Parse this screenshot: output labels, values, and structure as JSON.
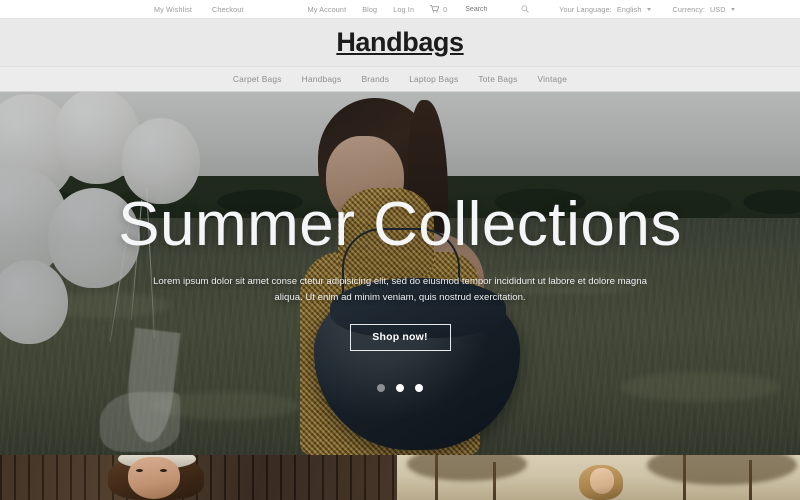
{
  "topbar": {
    "left_links": [
      {
        "label": "My Wishlist",
        "name": "my-wishlist-link"
      },
      {
        "label": "Checkout",
        "name": "checkout-link"
      }
    ],
    "mid_links": [
      {
        "label": "My Account",
        "name": "my-account-link"
      },
      {
        "label": "Blog",
        "name": "blog-link"
      },
      {
        "label": "Log In",
        "name": "log-in-link"
      }
    ],
    "cart": {
      "icon": "shopping-cart-icon",
      "count": "0"
    },
    "search": {
      "placeholder": "Search",
      "value": "",
      "icon": "search-icon"
    },
    "language": {
      "label": "Your Language:",
      "value": "English"
    },
    "currency": {
      "label": "Currency:",
      "value": "USD"
    }
  },
  "header": {
    "logo": "Handbags"
  },
  "nav": {
    "items": [
      {
        "label": "Carpet Bags",
        "name": "nav-carpet-bags"
      },
      {
        "label": "Handbags",
        "name": "nav-handbags"
      },
      {
        "label": "Brands",
        "name": "nav-brands"
      },
      {
        "label": "Laptop Bags",
        "name": "nav-laptop-bags"
      },
      {
        "label": "Tote Bags",
        "name": "nav-tote-bags"
      },
      {
        "label": "Vintage",
        "name": "nav-vintage"
      }
    ]
  },
  "hero": {
    "title": "Summer Collections",
    "subtitle": "Lorem ipsum dolor sit amet conse ctetur adipisicing elit, sed do eiusmod tempor incididunt ut labore et dolore magna aliqua. Ut enim ad minim veniam, quis nostrud exercitation.",
    "cta": "Shop now!",
    "slides": [
      {
        "index": "1",
        "active": true
      },
      {
        "index": "2",
        "active": false
      },
      {
        "index": "3",
        "active": false
      }
    ]
  },
  "colors": {
    "topbar_bg": "#ffffff",
    "logo_band_bg": "#e9e9e9",
    "nav_band_bg": "#ececec",
    "muted_text": "#9a9a9a",
    "nav_text": "#8e8e8e",
    "logo_text": "#1c1c1c",
    "hero_text": "#ffffff",
    "dot_active": "#8d9095",
    "dot_inactive": "#ffffff"
  }
}
